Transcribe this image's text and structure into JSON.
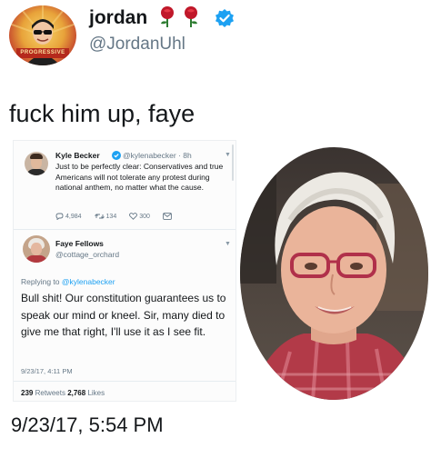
{
  "tweet": {
    "name": "jordan",
    "handle": "@JordanUhl",
    "text": "fuck him up, faye",
    "timestamp": "9/23/17, 5:54 PM",
    "avatar_banner": "PROGRESSIVE",
    "icons": [
      "rose-icon",
      "rose-icon",
      "verified-icon"
    ]
  },
  "embed": {
    "original": {
      "name": "Kyle Becker",
      "handle": "@kylenabecker · 8h",
      "text": "Just to be perfectly clear: Conservatives and true Americans will not tolerate any protest during national anthem, no matter what the cause.",
      "replies": "4,984",
      "retweets": "134",
      "likes": "300"
    },
    "reply": {
      "name": "Faye Fellows",
      "handle": "@cottage_orchard",
      "replying_label": "Replying to",
      "replying_mention": "@kylenabecker",
      "text": "Bull shit! Our constitution guarantees us to speak our mind or kneel. Sir, many died to give me that right, I'll use it as I see fit.",
      "timestamp": "9/23/17, 4:11 PM",
      "retweets_count": "239",
      "retweets_label": "Retweets",
      "likes_count": "2,768",
      "likes_label": "Likes"
    }
  },
  "colors": {
    "link": "#1da1f2",
    "secondary_text": "#657786",
    "rose": "#c0182a",
    "verified": "#1da1f2"
  }
}
